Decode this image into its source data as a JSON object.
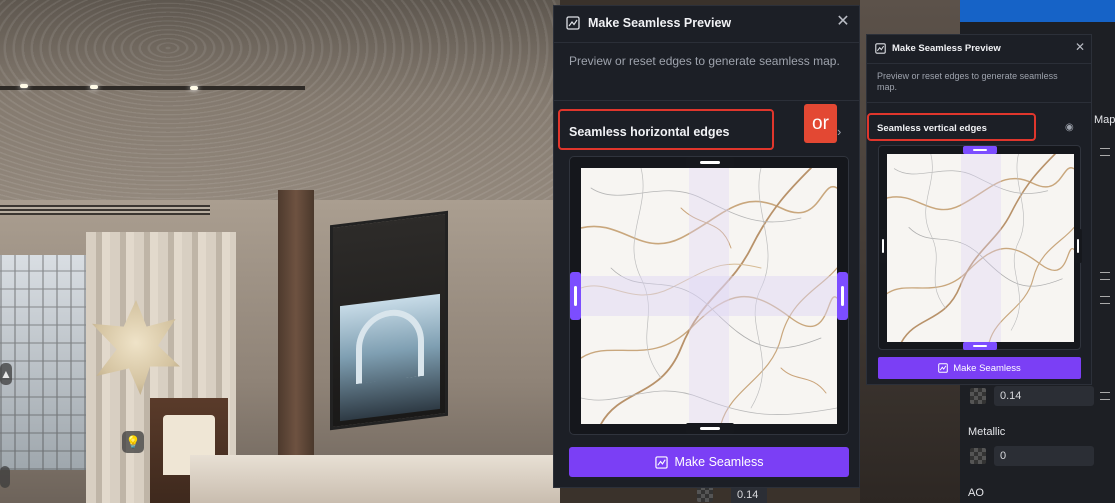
{
  "colors": {
    "accent": "#7b3ff5",
    "highlight_red": "#e0362c",
    "dialog_bg": "#1c1f26"
  },
  "main_dialog": {
    "icon": "seamless-preview-icon",
    "title": "Make Seamless Preview",
    "close_icon": "close-icon",
    "description": "Preview or reset edges to generate seamless map.",
    "section_label": "Seamless horizontal edges",
    "button_label": "Make Seamless",
    "button_icon": "seamless-icon"
  },
  "or_badge": "or",
  "small_dialog": {
    "icon": "seamless-preview-icon",
    "title": "Make Seamless Preview",
    "close_icon": "close-icon",
    "description": "Preview or reset edges to generate seamless map.",
    "section_label": "Seamless vertical edges",
    "visibility_icon": "eye-icon",
    "button_label": "Make Seamless",
    "button_icon": "seamless-icon"
  },
  "properties_panel": {
    "map_label": "Map",
    "roughness_value": "0.14",
    "metallic_label": "Metallic",
    "metallic_value": "0",
    "ao_label": "AO",
    "bottom_value": "0.14"
  }
}
